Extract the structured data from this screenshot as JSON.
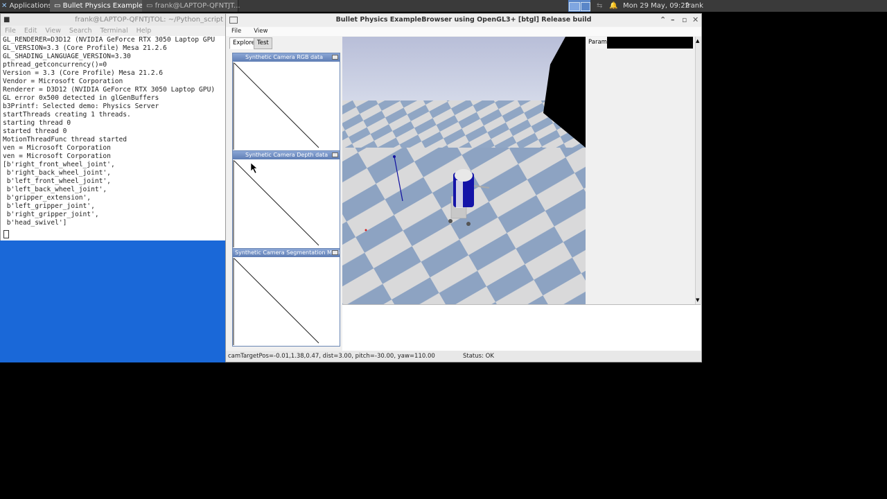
{
  "panel": {
    "apps_label": "Applications",
    "task1": "Bullet Physics Example...",
    "task2": "frank@LAPTOP-QFNTJT...",
    "datetime": "Mon 29 May, 09:22",
    "user": "frank"
  },
  "terminal": {
    "title": "frank@LAPTOP-QFNTJTOL: ~/Python_script",
    "menu": [
      "File",
      "Edit",
      "View",
      "Search",
      "Terminal",
      "Help"
    ],
    "lines": [
      "GL_RENDERER=D3D12 (NVIDIA GeForce RTX 3050 Laptop GPU",
      "GL_VERSION=3.3 (Core Profile) Mesa 21.2.6",
      "GL_SHADING_LANGUAGE_VERSION=3.30",
      "pthread_getconcurrency()=0",
      "Version = 3.3 (Core Profile) Mesa 21.2.6",
      "Vendor = Microsoft Corporation",
      "Renderer = D3D12 (NVIDIA GeForce RTX 3050 Laptop GPU)",
      "GL error 0x500 detected in glGenBuffers",
      "b3Printf: Selected demo: Physics Server",
      "startThreads creating 1 threads.",
      "starting thread 0",
      "started thread 0",
      "MotionThreadFunc thread started",
      "ven = Microsoft Corporation",
      "ven = Microsoft Corporation",
      "[b'right_front_wheel_joint',",
      " b'right_back_wheel_joint',",
      " b'left_front_wheel_joint',",
      " b'left_back_wheel_joint',",
      " b'gripper_extension',",
      " b'left_gripper_joint',",
      " b'right_gripper_joint',",
      " b'head_swivel']"
    ]
  },
  "bullet": {
    "title": "Bullet Physics ExampleBrowser using OpenGL3+ [btgl] Release build",
    "menu_file": "File",
    "menu_view": "View",
    "tab_explorer": "Explorer",
    "tab_test": "Test",
    "cam_rgb": "Synthetic Camera RGB data",
    "cam_depth": "Synthetic Camera Depth data",
    "cam_seg": "Synthetic Camera Segmentation Mask",
    "params": "Params",
    "status_left": "camTargetPos=-0.01,1.38,0.47, dist=3.00, pitch=-30.00, yaw=110.00",
    "status_right": "Status: OK"
  }
}
